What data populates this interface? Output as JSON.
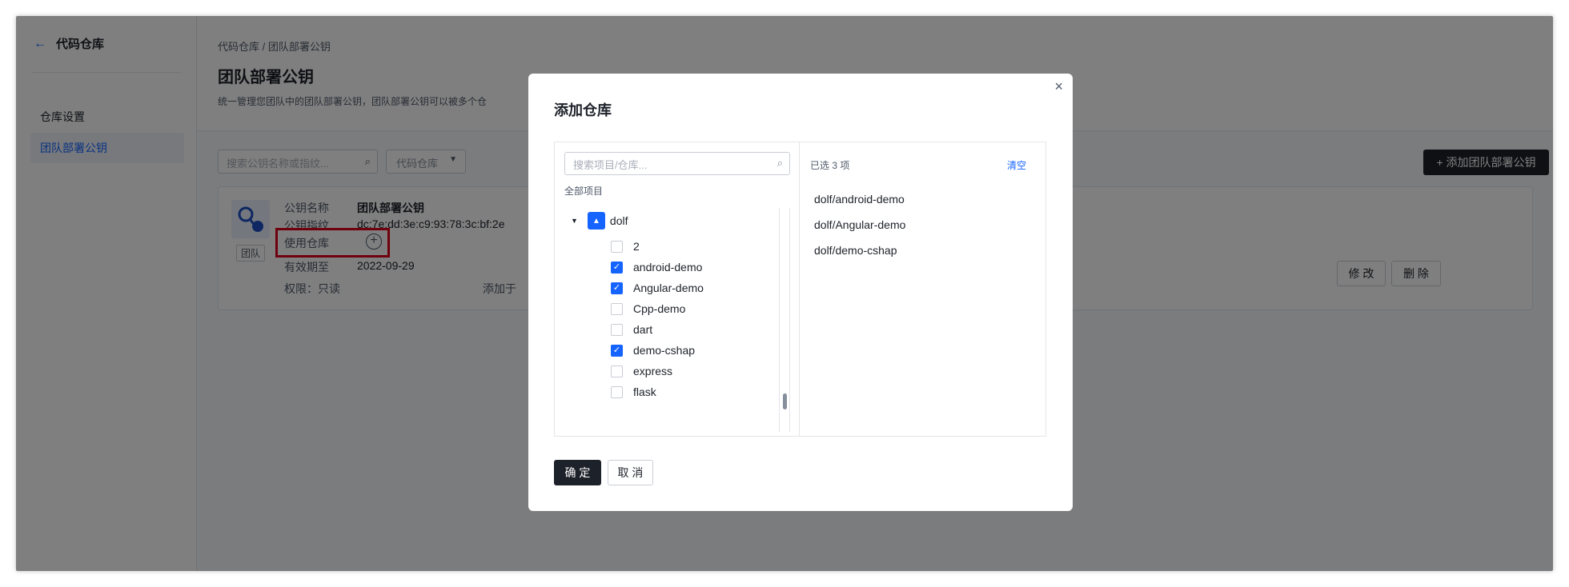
{
  "sidebar": {
    "back_label": "代码仓库",
    "items": [
      {
        "label": "仓库设置",
        "active": false
      },
      {
        "label": "团队部署公钥",
        "active": true
      }
    ]
  },
  "header": {
    "breadcrumb": "代码仓库 / 团队部署公钥",
    "title": "团队部署公钥",
    "description": "统一管理您团队中的团队部署公钥，团队部署公钥可以被多个仓"
  },
  "toolbar": {
    "search_placeholder": "搜索公钥名称或指纹...",
    "filter_label": "代码仓库",
    "add_button": "+ 添加团队部署公钥"
  },
  "key_card": {
    "tag": "团队",
    "name_label": "公钥名称",
    "name_value": "团队部署公钥",
    "fingerprint_label": "公钥指纹",
    "fingerprint_value": "dc:7e:dd:3e:c9:93:78:3c:bf:2e",
    "repos_label": "使用仓库",
    "expiry_label": "有效期至",
    "expiry_value": "2022-09-29",
    "permission": "权限：只读",
    "added_text": "添加于",
    "edit_button": "修 改",
    "delete_button": "删 除"
  },
  "modal": {
    "title": "添加仓库",
    "close_icon": "×",
    "search_placeholder": "搜索项目/仓库...",
    "all_projects": "全部项目",
    "tree_root": "dolf",
    "repos": [
      {
        "name": "2",
        "checked": false
      },
      {
        "name": "android-demo",
        "checked": true
      },
      {
        "name": "Angular-demo",
        "checked": true
      },
      {
        "name": "Cpp-demo",
        "checked": false
      },
      {
        "name": "dart",
        "checked": false
      },
      {
        "name": "demo-cshap",
        "checked": true
      },
      {
        "name": "express",
        "checked": false
      },
      {
        "name": "flask",
        "checked": false
      }
    ],
    "selected_count": "已选 3 项",
    "clear_label": "清空",
    "selected": [
      "dolf/android-demo",
      "dolf/Angular-demo",
      "dolf/demo-cshap"
    ],
    "ok_button": "确 定",
    "cancel_button": "取 消"
  },
  "colors": {
    "accent": "#1664ff",
    "dark_button": "#1d2129",
    "highlight": "#e0001a"
  }
}
